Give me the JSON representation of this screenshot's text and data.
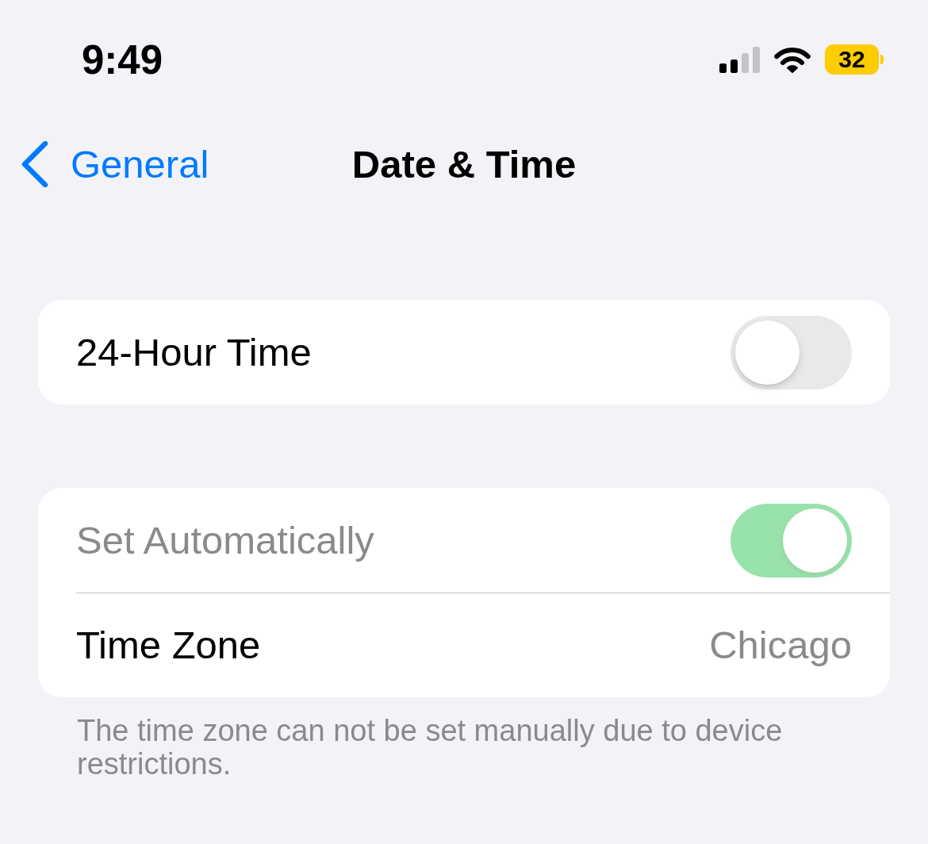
{
  "status_bar": {
    "time": "9:49",
    "battery": "32"
  },
  "nav": {
    "back": "General",
    "title": "Date & Time"
  },
  "groups": [
    {
      "rows": [
        {
          "kind": "toggle",
          "label": "24-Hour Time",
          "on": false,
          "disabled": false
        }
      ]
    },
    {
      "rows": [
        {
          "kind": "toggle",
          "label": "Set Automatically",
          "on": true,
          "disabled": true
        },
        {
          "kind": "value",
          "label": "Time Zone",
          "value": "Chicago",
          "disabled": false
        }
      ],
      "footer": "The time zone can not be set manually due to device restrictions."
    }
  ]
}
